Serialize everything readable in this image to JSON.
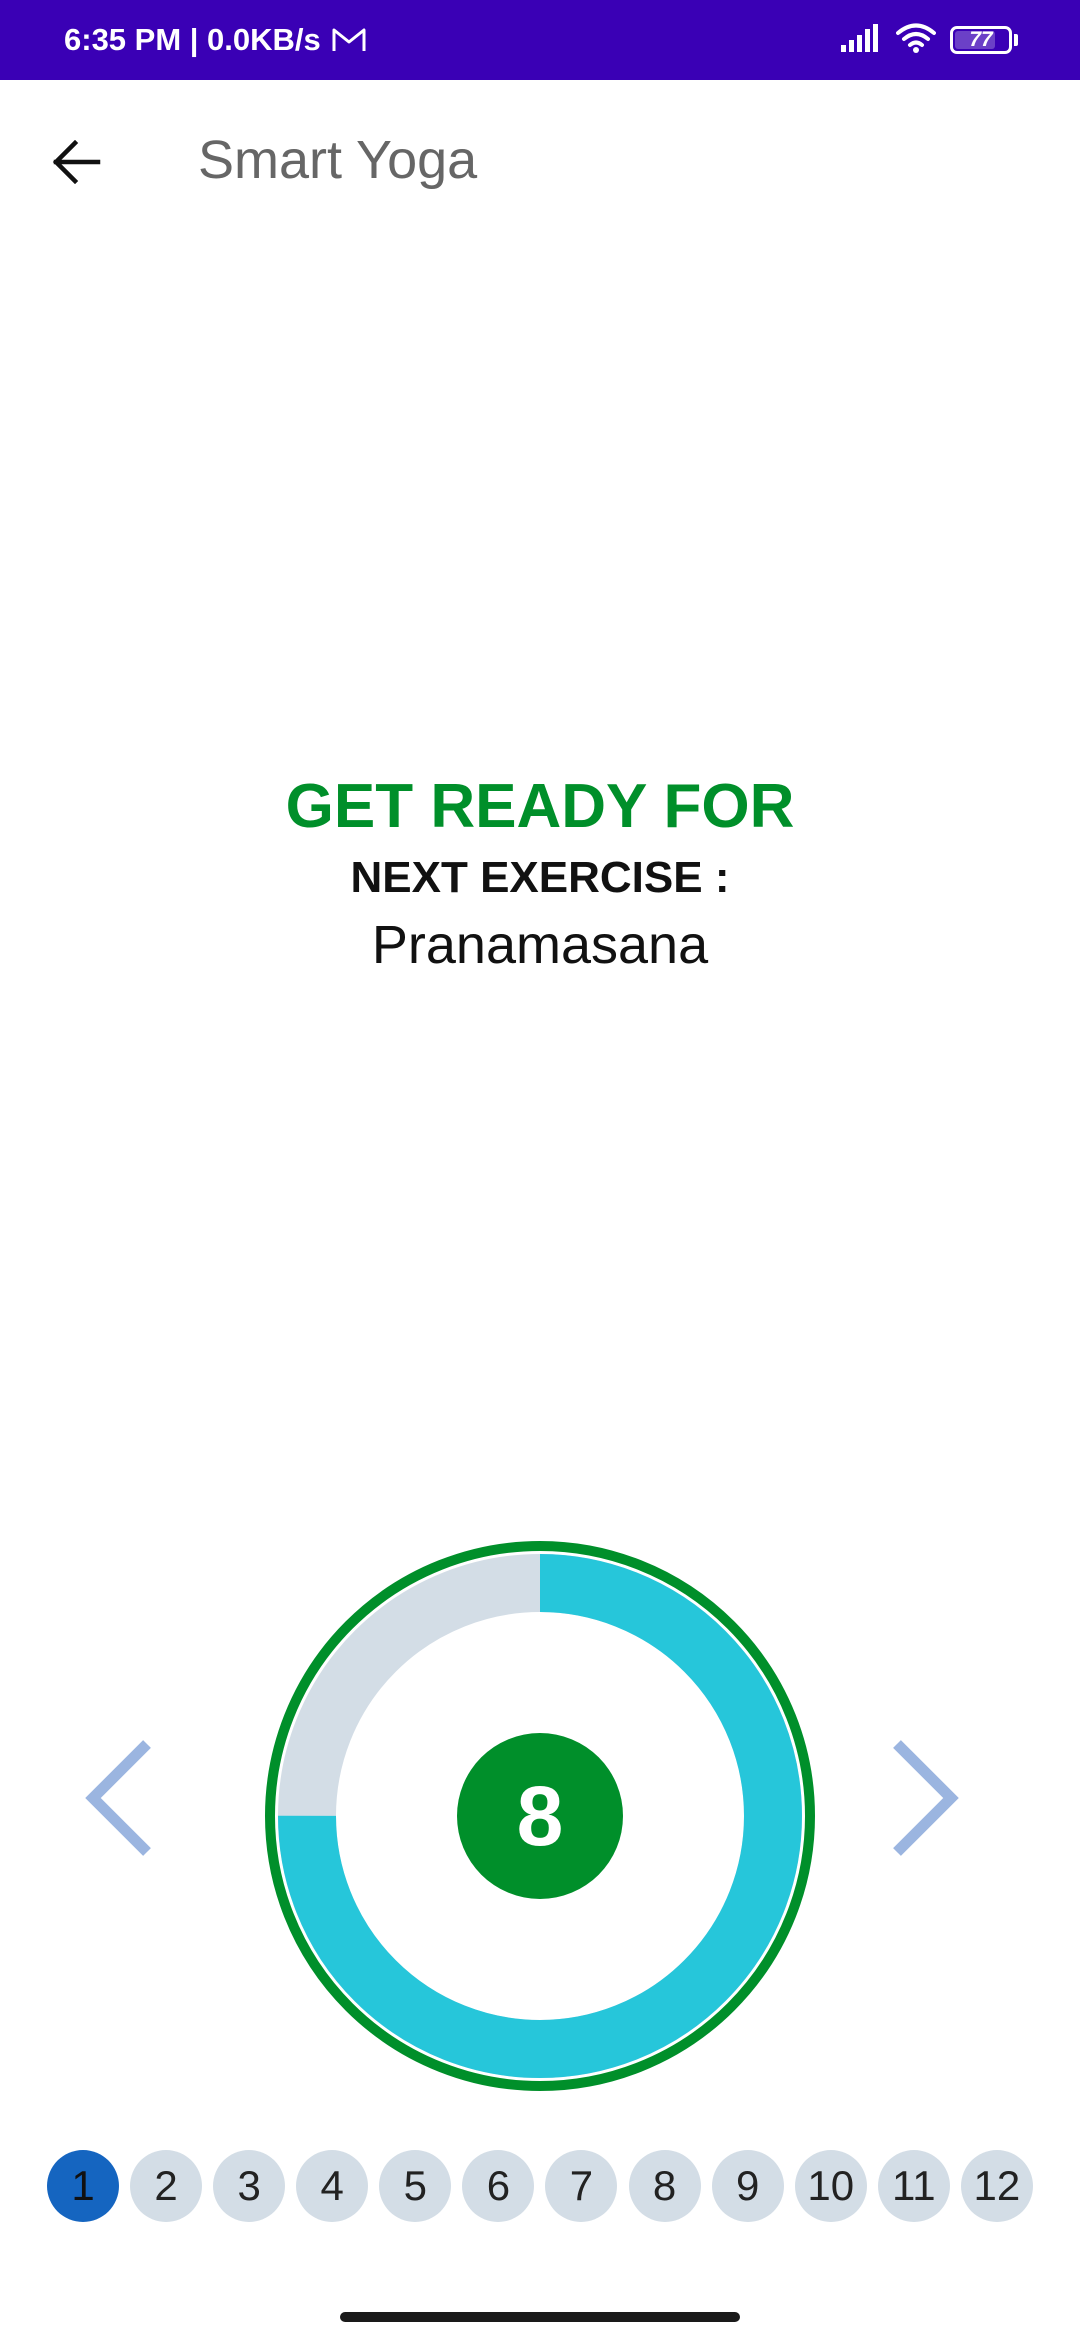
{
  "status_bar": {
    "time_speed": "6:35 PM | 0.0KB/s",
    "battery": "77",
    "battery_level": 0.77,
    "background_color": "#3a00b5",
    "icons": [
      "gmail-icon",
      "signal-icon",
      "wifi-icon",
      "battery-icon"
    ]
  },
  "app_bar": {
    "title": "Smart Yoga",
    "back_icon": "arrow-left-icon"
  },
  "main": {
    "heading": "GET READY FOR",
    "next_label": "NEXT EXERCISE :",
    "exercise_name": "Pranamasana"
  },
  "timer": {
    "count": "8",
    "progress_fraction": 0.75,
    "colors": {
      "ring_outer": "#008f2a",
      "progress": "#26c6da",
      "track": "#d3dde6",
      "badge": "#008f2a"
    }
  },
  "navigation": {
    "prev_icon": "chevron-left-icon",
    "next_icon": "chevron-right-icon",
    "arrow_color": "#9bb5e0"
  },
  "steps": {
    "active_index": 0,
    "active_color": "#1565c0",
    "items": [
      "1",
      "2",
      "3",
      "4",
      "5",
      "6",
      "7",
      "8",
      "9",
      "10",
      "11",
      "12"
    ]
  }
}
